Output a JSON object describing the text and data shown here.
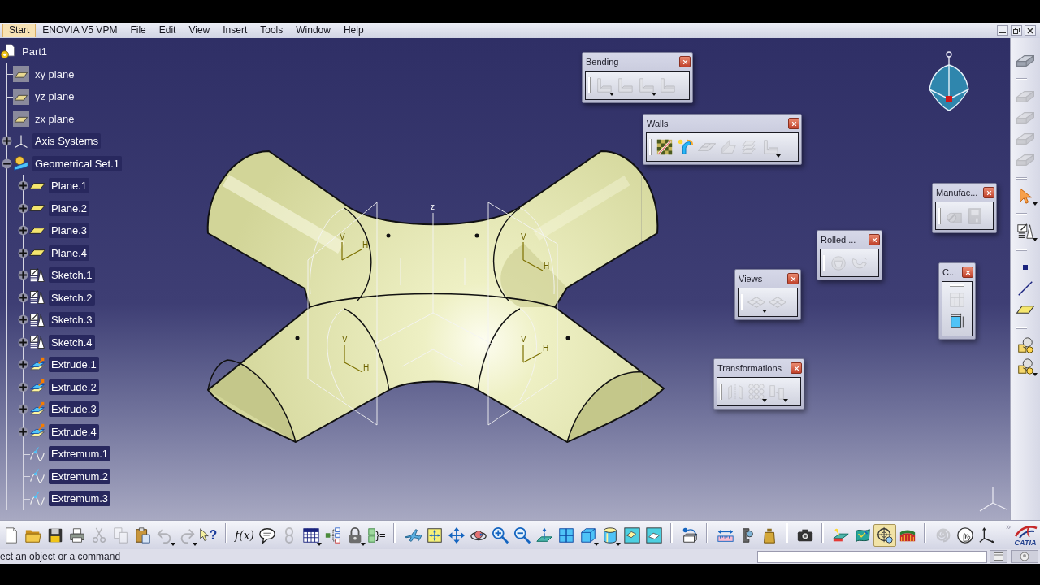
{
  "menu_bar": {
    "items": [
      {
        "label": "Start",
        "selected": true
      },
      {
        "label": "ENOVIA V5 VPM",
        "selected": false
      },
      {
        "label": "File",
        "selected": false
      },
      {
        "label": "Edit",
        "selected": false
      },
      {
        "label": "View",
        "selected": false
      },
      {
        "label": "Insert",
        "selected": false
      },
      {
        "label": "Tools",
        "selected": false
      },
      {
        "label": "Window",
        "selected": false
      },
      {
        "label": "Help",
        "selected": false
      }
    ]
  },
  "tree": [
    {
      "label": "Part1",
      "kind": "part",
      "selected": false,
      "children": [
        {
          "label": "xy plane",
          "kind": "reference_plane",
          "selected": false
        },
        {
          "label": "yz plane",
          "kind": "reference_plane",
          "selected": false
        },
        {
          "label": "zx plane",
          "kind": "reference_plane",
          "selected": false
        },
        {
          "label": "Axis Systems",
          "kind": "axis_system",
          "selected": true,
          "expanded": false
        },
        {
          "label": "Geometrical Set.1",
          "kind": "geometrical_set",
          "selected": true,
          "expanded": true,
          "children": [
            {
              "label": "Plane.1",
              "kind": "plane",
              "selected": true,
              "expanded": false
            },
            {
              "label": "Plane.2",
              "kind": "plane",
              "selected": true,
              "expanded": false
            },
            {
              "label": "Plane.3",
              "kind": "plane",
              "selected": true,
              "expanded": false
            },
            {
              "label": "Plane.4",
              "kind": "plane",
              "selected": true,
              "expanded": false
            },
            {
              "label": "Sketch.1",
              "kind": "sketch",
              "selected": true,
              "expanded": false
            },
            {
              "label": "Sketch.2",
              "kind": "sketch",
              "selected": true,
              "expanded": false
            },
            {
              "label": "Sketch.3",
              "kind": "sketch",
              "selected": true,
              "expanded": false
            },
            {
              "label": "Sketch.4",
              "kind": "sketch",
              "selected": true,
              "expanded": false
            },
            {
              "label": "Extrude.1",
              "kind": "extrude",
              "selected": true,
              "expanded": false
            },
            {
              "label": "Extrude.2",
              "kind": "extrude",
              "selected": true,
              "expanded": false
            },
            {
              "label": "Extrude.3",
              "kind": "extrude",
              "selected": true,
              "expanded": false
            },
            {
              "label": "Extrude.4",
              "kind": "extrude",
              "selected": true,
              "expanded": false
            },
            {
              "label": "Extremum.1",
              "kind": "extremum",
              "selected": true
            },
            {
              "label": "Extremum.2",
              "kind": "extremum",
              "selected": true
            },
            {
              "label": "Extremum.3",
              "kind": "extremum",
              "selected": true
            }
          ]
        }
      ]
    }
  ],
  "viewport": {
    "origin_label": "z",
    "sketch_axes": [
      {
        "v": "V",
        "h": "H"
      },
      {
        "v": "V",
        "h": "H"
      },
      {
        "v": "V",
        "h": "H"
      },
      {
        "v": "V",
        "h": "H"
      }
    ]
  },
  "toolbars": [
    {
      "title": "Bending",
      "vertical": false,
      "tools": [
        {
          "disabled": true,
          "kind": "menu"
        },
        {
          "disabled": true,
          "kind": "button"
        },
        {
          "disabled": true,
          "kind": "menu"
        },
        {
          "disabled": true,
          "kind": "button"
        }
      ]
    },
    {
      "title": "Walls",
      "vertical": false,
      "tools": [
        {
          "disabled": false,
          "kind": "button"
        },
        {
          "disabled": false,
          "kind": "button"
        },
        {
          "disabled": true,
          "kind": "button"
        },
        {
          "disabled": true,
          "kind": "button"
        },
        {
          "disabled": true,
          "kind": "button"
        },
        {
          "disabled": true,
          "kind": "menu"
        }
      ]
    },
    {
      "title": "Manufac...",
      "vertical": false,
      "tools": [
        {
          "disabled": true,
          "kind": "button"
        },
        {
          "disabled": true,
          "kind": "button"
        }
      ]
    },
    {
      "title": "Rolled ...",
      "vertical": false,
      "tools": [
        {
          "disabled": true,
          "kind": "button"
        },
        {
          "disabled": true,
          "kind": "button"
        }
      ]
    },
    {
      "title": "C...",
      "vertical": true,
      "tools": [
        {
          "disabled": true,
          "kind": "button"
        },
        {
          "disabled": false,
          "kind": "button"
        }
      ]
    },
    {
      "title": "Views",
      "vertical": false,
      "tools": [
        {
          "disabled": true,
          "kind": "menu"
        },
        {
          "disabled": true,
          "kind": "button"
        }
      ]
    },
    {
      "title": "Transformations",
      "vertical": false,
      "tools": [
        {
          "disabled": true,
          "kind": "button"
        },
        {
          "disabled": true,
          "kind": "menu"
        },
        {
          "disabled": true,
          "kind": "menu"
        }
      ]
    }
  ],
  "right_toolbar": {
    "groups": [
      [
        {
          "disabled": false,
          "kind": "button"
        }
      ],
      [
        {
          "disabled": true,
          "kind": "button"
        },
        {
          "disabled": true,
          "kind": "button"
        },
        {
          "disabled": true,
          "kind": "button"
        },
        {
          "disabled": true,
          "kind": "button"
        }
      ],
      [
        {
          "disabled": false,
          "kind": "menu"
        }
      ],
      [
        {
          "disabled": false,
          "kind": "menu"
        }
      ],
      [
        {
          "disabled": false,
          "kind": "button"
        },
        {
          "disabled": false,
          "kind": "button"
        },
        {
          "disabled": false,
          "kind": "button"
        }
      ],
      [
        {
          "disabled": false,
          "kind": "button"
        },
        {
          "disabled": false,
          "kind": "menu"
        }
      ]
    ]
  },
  "bottom_toolbar": {
    "groups": [
      [
        {
          "disabled": false,
          "kind": "button"
        },
        {
          "disabled": false,
          "kind": "button"
        },
        {
          "disabled": false,
          "kind": "button"
        },
        {
          "disabled": false,
          "kind": "button"
        },
        {
          "disabled": true,
          "kind": "button"
        },
        {
          "disabled": true,
          "kind": "button"
        },
        {
          "disabled": false,
          "kind": "button"
        },
        {
          "disabled": true,
          "kind": "menu"
        },
        {
          "disabled": true,
          "kind": "menu"
        },
        {
          "disabled": false,
          "kind": "button",
          "label": "?"
        }
      ],
      [
        {
          "disabled": false,
          "kind": "button",
          "label": "f(x)"
        },
        {
          "disabled": false,
          "kind": "button"
        },
        {
          "disabled": true,
          "kind": "button"
        },
        {
          "disabled": false,
          "kind": "menu"
        },
        {
          "disabled": false,
          "kind": "button"
        },
        {
          "disabled": false,
          "kind": "menu"
        },
        {
          "disabled": false,
          "kind": "button",
          "label": "}="
        }
      ],
      [
        {
          "disabled": false,
          "kind": "button"
        },
        {
          "disabled": false,
          "kind": "button"
        },
        {
          "disabled": false,
          "kind": "button"
        },
        {
          "disabled": false,
          "kind": "button"
        },
        {
          "disabled": false,
          "kind": "button"
        },
        {
          "disabled": false,
          "kind": "button"
        },
        {
          "disabled": false,
          "kind": "button"
        },
        {
          "disabled": false,
          "kind": "button"
        },
        {
          "disabled": false,
          "kind": "menu"
        },
        {
          "disabled": false,
          "kind": "menu"
        },
        {
          "disabled": false,
          "kind": "button"
        },
        {
          "disabled": false,
          "kind": "button"
        }
      ],
      [
        {
          "disabled": false,
          "kind": "button"
        }
      ],
      [
        {
          "disabled": false,
          "kind": "button"
        },
        {
          "disabled": false,
          "kind": "button"
        },
        {
          "disabled": false,
          "kind": "button"
        }
      ],
      [
        {
          "disabled": false,
          "kind": "button"
        }
      ],
      [
        {
          "disabled": false,
          "kind": "button",
          "on": false
        },
        {
          "disabled": false,
          "kind": "button",
          "on": false
        },
        {
          "disabled": false,
          "kind": "button",
          "on": true
        },
        {
          "disabled": false,
          "kind": "button",
          "on": false
        }
      ],
      [
        {
          "disabled": true,
          "kind": "button"
        },
        {
          "disabled": false,
          "kind": "button"
        },
        {
          "disabled": false,
          "kind": "button"
        }
      ]
    ],
    "overflow": "»",
    "logo_text": "CATIA"
  },
  "status_bar": {
    "message": "ect an object or a command"
  }
}
